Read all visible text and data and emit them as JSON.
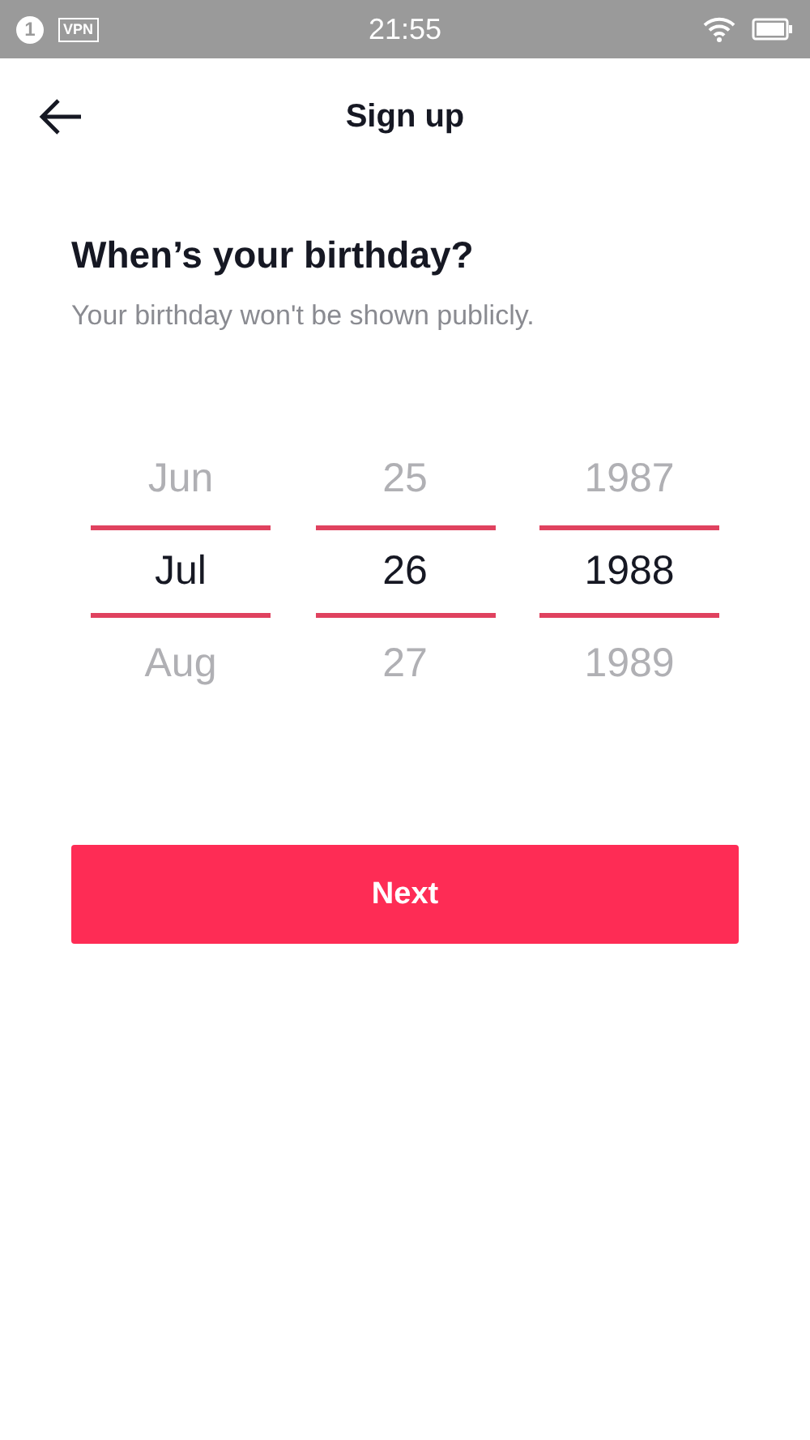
{
  "status_bar": {
    "notification_count": "1",
    "vpn": "VPN",
    "time": "21:55"
  },
  "header": {
    "title": "Sign up"
  },
  "heading": "When’s your birthday?",
  "subtitle": "Your birthday won't be shown publicly.",
  "pickers": [
    {
      "options": [
        {
          "label": "Jun",
          "selected": false
        },
        {
          "label": "Jul",
          "selected": true
        },
        {
          "label": "Aug",
          "selected": false
        }
      ]
    },
    {
      "options": [
        {
          "label": "25",
          "selected": false
        },
        {
          "label": "26",
          "selected": true
        },
        {
          "label": "27",
          "selected": false
        }
      ]
    },
    {
      "options": [
        {
          "label": "1987",
          "selected": false
        },
        {
          "label": "1988",
          "selected": true
        },
        {
          "label": "1989",
          "selected": false
        }
      ]
    }
  ],
  "next_button": "Next"
}
